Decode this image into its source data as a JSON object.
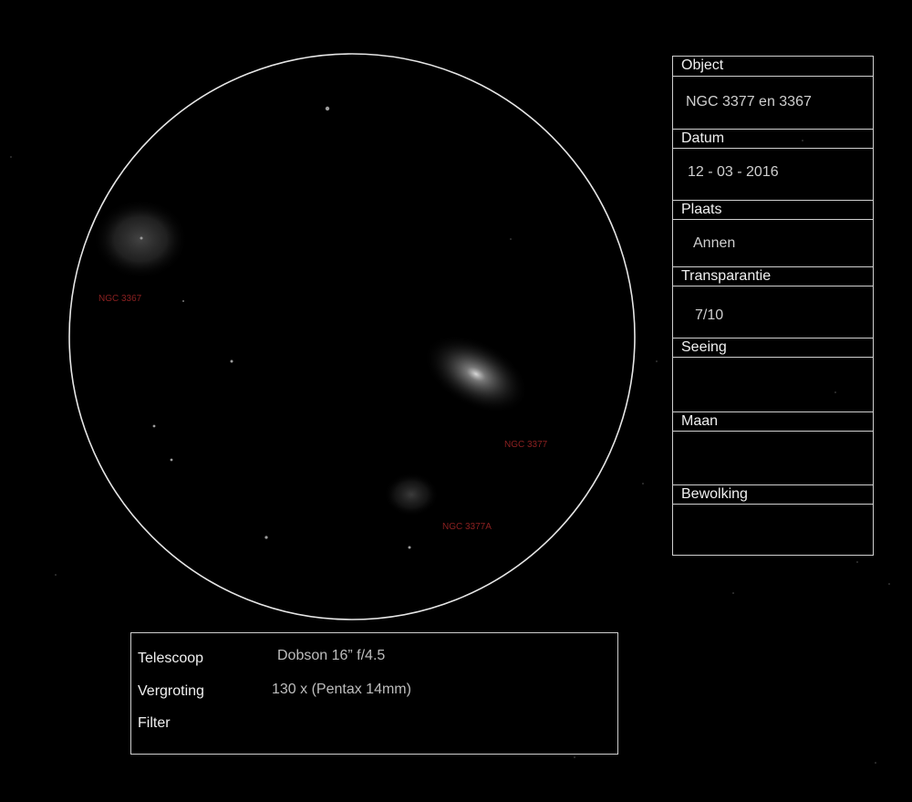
{
  "field_of_view": {
    "galaxies": [
      {
        "label": "NGC 3367"
      },
      {
        "label": "NGC 3377"
      },
      {
        "label": "NGC 3377A"
      }
    ]
  },
  "observation": {
    "object_label": "Object",
    "object_value": "NGC 3377 en 3367",
    "date_label": "Datum",
    "date_value": "12 - 03 - 2016",
    "place_label": "Plaats",
    "place_value": "Annen",
    "transparency_label": "Transparantie",
    "transparency_value": "7/10",
    "seeing_label": "Seeing",
    "seeing_value": "",
    "moon_label": "Maan",
    "moon_value": "",
    "clouds_label": "Bewolking",
    "clouds_value": ""
  },
  "equipment": {
    "telescope_label": "Telescoop",
    "telescope_value": "Dobson 16” f/4.5",
    "magnification_label": "Vergroting",
    "magnification_value": "130 x (Pentax 14mm)",
    "filter_label": "Filter",
    "filter_value": ""
  },
  "colors": {
    "background": "#000000",
    "line": "#e6e6e6",
    "label_red": "#8a2020"
  }
}
